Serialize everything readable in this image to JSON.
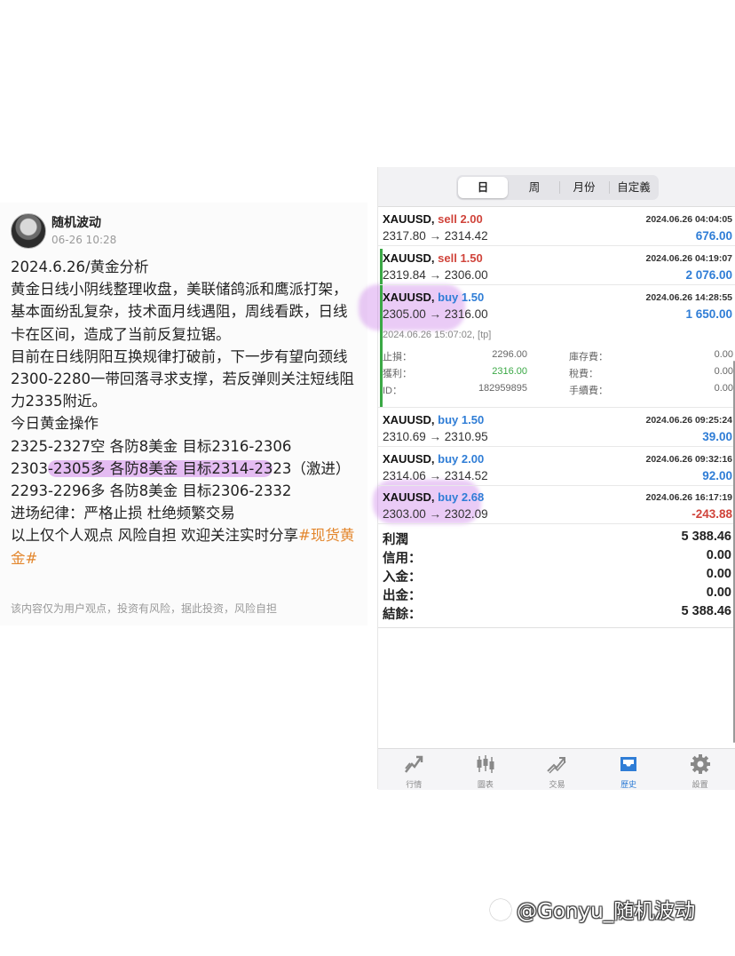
{
  "post": {
    "author": "随机波动",
    "time": "06-26 10:28",
    "lines": [
      "2024.6.26/黄金分析",
      "黄金日线小阴线整理收盘，美联储鸽派和鹰派打架，基本面纷乱复杂，技术面月线遇阻，周线看跌，日线卡在区间，造成了当前反复拉锯。",
      "目前在日线阴阳互换规律打破前，下一步有望向颈线2300-2280一带回落寻求支撑，若反弹则关注短线阻力2335附近。",
      "今日黄金操作",
      "2325-2327空 各防8美金 目标2316-2306"
    ],
    "line6_pre": "2303",
    "line6_hl": "-2305多 各防8美金 目标2314-23",
    "line6_post": "23（激进）",
    "line7": "2293-2296多 各防8美金 目标2306-2332",
    "line8": "进场纪律：严格止损 杜绝频繁交易",
    "line9_text": "以上仅个人观点 风险自担 欢迎关注实时分享",
    "line9_tag": "#现货黄金#",
    "disclaimer": "该内容仅为用户观点，投资有风险，据此投资，风险自担"
  },
  "app": {
    "segments": [
      "日",
      "周",
      "月份",
      "自定義"
    ],
    "active_segment": "日",
    "trades": [
      {
        "symbol": "XAUUSD,",
        "side": "sell",
        "lots": "2.00",
        "date": "2024.06.26 04:04:05",
        "price": "2317.80 → 2314.42",
        "profit": "676.00",
        "profit_sign": "pos"
      },
      {
        "symbol": "XAUUSD,",
        "side": "sell",
        "lots": "1.50",
        "date": "2024.06.26 04:19:07",
        "price": "2319.84 → 2306.00",
        "profit": "2 076.00",
        "profit_sign": "pos"
      },
      {
        "symbol": "XAUUSD,",
        "side": "buy",
        "lots": "1.50",
        "date": "2024.06.26 14:28:55",
        "price": "2305.00 → 2316.00",
        "profit": "1 650.00",
        "profit_sign": "pos"
      },
      {
        "symbol": "XAUUSD,",
        "side": "buy",
        "lots": "1.50",
        "date": "2024.06.26 09:25:24",
        "price": "2310.69 → 2310.95",
        "profit": "39.00",
        "profit_sign": "pos"
      },
      {
        "symbol": "XAUUSD,",
        "side": "buy",
        "lots": "2.00",
        "date": "2024.06.26 09:32:16",
        "price": "2314.06 → 2314.52",
        "profit": "92.00",
        "profit_sign": "pos"
      },
      {
        "symbol": "XAUUSD,",
        "side": "buy",
        "lots": "2.68",
        "date": "2024.06.26 16:17:19",
        "price": "2303.00 → 2302.09",
        "profit": "-243.88",
        "profit_sign": "neg"
      }
    ],
    "details": {
      "close_time": "2024.06.26 15:07:02, [tp]",
      "sl_label": "止損：",
      "sl": "2296.00",
      "swap_label": "庫存費：",
      "swap": "0.00",
      "tp_label": "獲利：",
      "tp": "2316.00",
      "tax_label": "稅費：",
      "tax": "0.00",
      "id_label": "ID：",
      "id": "182959895",
      "fee_label": "手續費：",
      "fee": "0.00"
    },
    "summary": [
      {
        "label": "利潤",
        "value": "5 388.46"
      },
      {
        "label": "信用：",
        "value": "0.00"
      },
      {
        "label": "入金：",
        "value": "0.00"
      },
      {
        "label": "出金：",
        "value": "0.00"
      },
      {
        "label": "結餘：",
        "value": "5 388.46"
      }
    ],
    "tabs": [
      {
        "label": "行情",
        "icon": "quotes-icon"
      },
      {
        "label": "圖表",
        "icon": "chart-icon"
      },
      {
        "label": "交易",
        "icon": "trade-icon"
      },
      {
        "label": "歷史",
        "icon": "history-icon"
      },
      {
        "label": "設置",
        "icon": "settings-icon"
      }
    ],
    "active_tab": "歷史",
    "colors": {
      "sell": "#d0443b",
      "buy": "#2f7dd6",
      "highlight": "#c86ee6",
      "active_tab": "#2f7dd6"
    }
  },
  "watermark": "@Gonyu_随机波动"
}
